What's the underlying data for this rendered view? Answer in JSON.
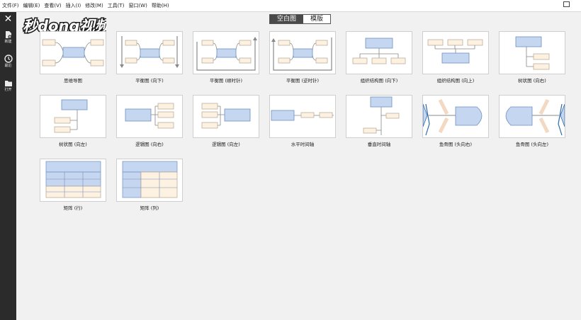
{
  "menu": [
    "文件(F)",
    "编辑(E)",
    "查看(V)",
    "插入(I)",
    "修改(M)",
    "工具(T)",
    "窗口(W)",
    "帮助(H)"
  ],
  "sidebar": {
    "new_label": "新建",
    "recent_label": "最近",
    "open_label": "打开"
  },
  "logo": {
    "text": "秒dong视频"
  },
  "toggle": {
    "blank_label": "空白图",
    "template_label": "模版"
  },
  "templates": [
    {
      "name": "思维导图"
    },
    {
      "name": "平衡图 (向下)"
    },
    {
      "name": "平衡图 (顺时针)"
    },
    {
      "name": "平衡图 (逆时针)"
    },
    {
      "name": "组织结构图 (向下)"
    },
    {
      "name": "组织结构图 (向上)"
    },
    {
      "name": "树状图 (向右)"
    },
    {
      "name": "树状图 (向左)"
    },
    {
      "name": "逻辑图 (向右)"
    },
    {
      "name": "逻辑图 (向左)"
    },
    {
      "name": "水平时间轴"
    },
    {
      "name": "垂直时间轴"
    },
    {
      "name": "鱼骨图 (头向右)"
    },
    {
      "name": "鱼骨图 (头向左)"
    },
    {
      "name": "矩阵 (行)"
    },
    {
      "name": "矩阵 (列)"
    }
  ],
  "colors": {
    "node_main": "#c5d6f0",
    "node_main_border": "#6f8fc2",
    "node_sub": "#fdf1e1",
    "node_sub_border": "#b3a590",
    "sidebar_bg": "#2b2b2b"
  }
}
